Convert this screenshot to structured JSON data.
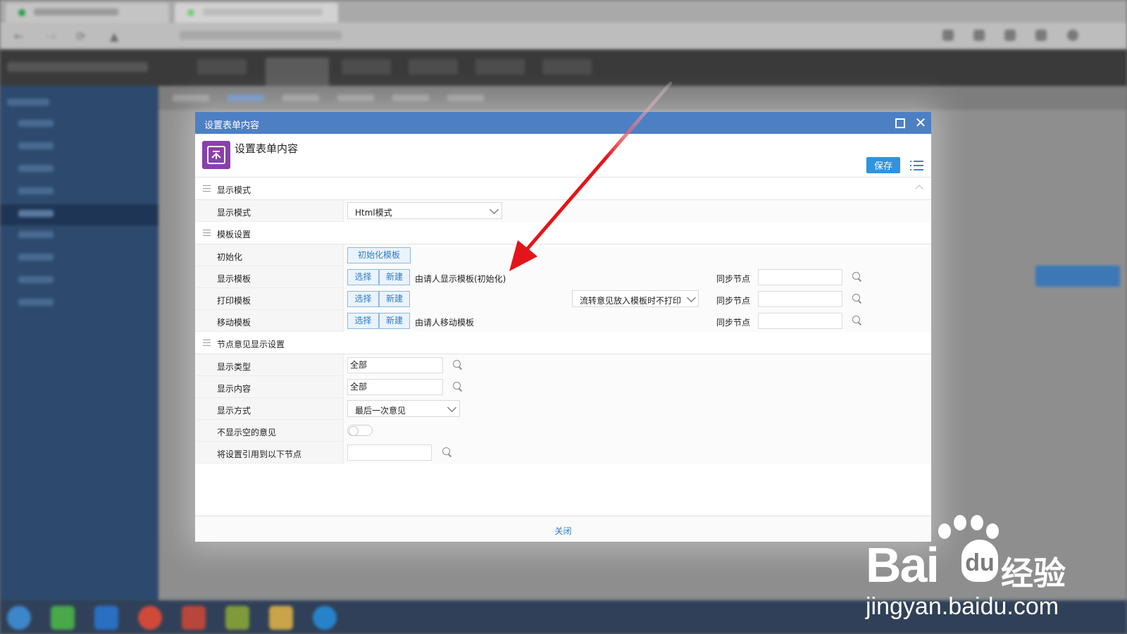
{
  "modal": {
    "title": "设置表单内容",
    "header_title": "设置表单内容",
    "save_label": "保存",
    "footer_close": "关闭"
  },
  "sections": {
    "display_mode": {
      "title": "显示模式",
      "row_label": "显示模式",
      "select_value": "Html模式"
    },
    "template": {
      "title": "模板设置",
      "init": {
        "label": "初始化",
        "button": "初始化模板"
      },
      "display": {
        "label": "显示模板",
        "select_btn": "选择",
        "new_btn": "新建",
        "current": "由请人显示模板(初始化)",
        "sync_label": "同步节点",
        "sync_value": ""
      },
      "print": {
        "label": "打印模板",
        "select_btn": "选择",
        "new_btn": "新建",
        "option": "流转意见放入模板时不打印",
        "sync_label": "同步节点",
        "sync_value": ""
      },
      "mobile": {
        "label": "移动模板",
        "select_btn": "选择",
        "new_btn": "新建",
        "current": "由请人移动模板",
        "sync_label": "同步节点",
        "sync_value": ""
      }
    },
    "opinion": {
      "title": "节点意见显示设置",
      "type": {
        "label": "显示类型",
        "value": "全部"
      },
      "content": {
        "label": "显示内容",
        "value": "全部"
      },
      "method": {
        "label": "显示方式",
        "value": "最后一次意见"
      },
      "hide_empty": {
        "label": "不显示空的意见",
        "on": false
      },
      "apply": {
        "label": "将设置引用到以下节点",
        "value": ""
      }
    }
  },
  "watermark": {
    "brand": "Bai",
    "du": "du",
    "cn": "经验",
    "url": "jingyan.baidu.com"
  },
  "colors": {
    "title_bar": "#4d7fc4",
    "save_button": "#2f93e0",
    "logo": "#8a3fae",
    "arrow": "#e3151a",
    "sidebar": "#2d4a6e"
  }
}
